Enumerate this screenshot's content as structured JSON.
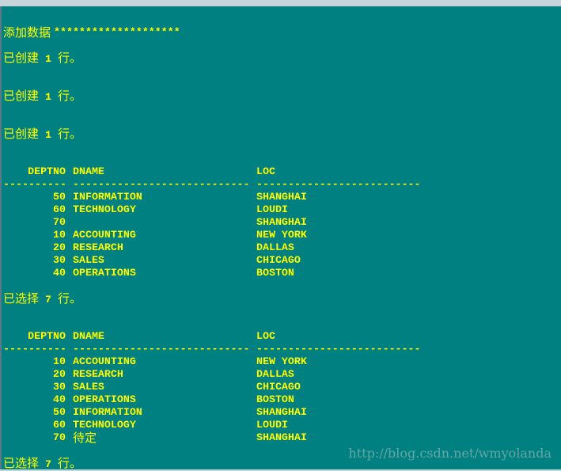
{
  "console": {
    "title": "添加数据",
    "stars": "********************",
    "created_msgs": [
      "已创建 1 行。",
      "已创建 1 行。",
      "已创建 1 行。"
    ],
    "tables": [
      {
        "headers": {
          "deptno": "DEPTNO",
          "dname": "DNAME",
          "loc": "LOC"
        },
        "dashes": {
          "deptno": "----------",
          "dname": "----------------------------",
          "loc": "--------------------------"
        },
        "rows": [
          {
            "deptno": "50",
            "dname": "INFORMATION",
            "loc": "SHANGHAI"
          },
          {
            "deptno": "60",
            "dname": "TECHNOLOGY",
            "loc": "LOUDI"
          },
          {
            "deptno": "70",
            "dname": "",
            "loc": "SHANGHAI"
          },
          {
            "deptno": "10",
            "dname": "ACCOUNTING",
            "loc": "NEW YORK"
          },
          {
            "deptno": "20",
            "dname": "RESEARCH",
            "loc": "DALLAS"
          },
          {
            "deptno": "30",
            "dname": "SALES",
            "loc": "CHICAGO"
          },
          {
            "deptno": "40",
            "dname": "OPERATIONS",
            "loc": "BOSTON"
          }
        ],
        "footer": "已选择 7 行。"
      },
      {
        "headers": {
          "deptno": "DEPTNO",
          "dname": "DNAME",
          "loc": "LOC"
        },
        "dashes": {
          "deptno": "----------",
          "dname": "----------------------------",
          "loc": "--------------------------"
        },
        "rows": [
          {
            "deptno": "10",
            "dname": "ACCOUNTING",
            "loc": "NEW YORK"
          },
          {
            "deptno": "20",
            "dname": "RESEARCH",
            "loc": "DALLAS"
          },
          {
            "deptno": "30",
            "dname": "SALES",
            "loc": "CHICAGO"
          },
          {
            "deptno": "40",
            "dname": "OPERATIONS",
            "loc": "BOSTON"
          },
          {
            "deptno": "50",
            "dname": "INFORMATION",
            "loc": "SHANGHAI"
          },
          {
            "deptno": "60",
            "dname": "TECHNOLOGY",
            "loc": "LOUDI"
          },
          {
            "deptno": "70",
            "dname": "待定",
            "loc": "SHANGHAI"
          }
        ],
        "footer": "已选择 7 行。"
      }
    ]
  },
  "watermark": "http://blog.csdn.net/wmyolanda",
  "colors": {
    "background": "#008080",
    "text": "#ffff00"
  }
}
